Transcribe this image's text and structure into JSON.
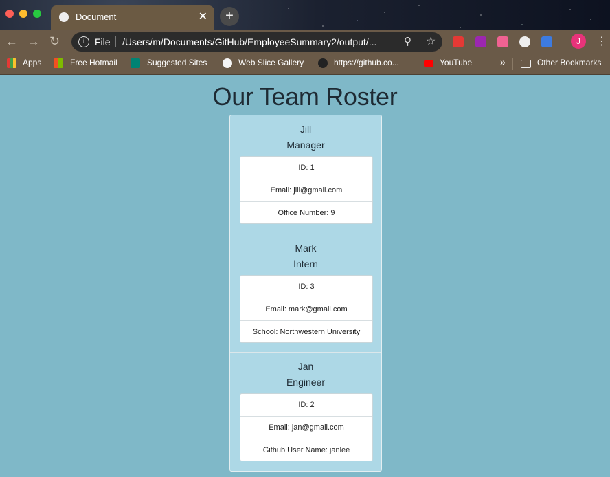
{
  "browser": {
    "tab_title": "Document",
    "url_scheme": "File",
    "url": "/Users/m/Documents/GitHub/EmployeeSummary2/output/...",
    "avatar_initial": "J"
  },
  "bookmarks": [
    {
      "label": "Apps",
      "icon": "apps-grid-icon"
    },
    {
      "label": "Free Hotmail",
      "icon": "microsoft-icon"
    },
    {
      "label": "Suggested Sites",
      "icon": "bing-icon"
    },
    {
      "label": "Web Slice Gallery",
      "icon": "web-slice-icon"
    },
    {
      "label": "https://github.co...",
      "icon": "github-icon"
    },
    {
      "label": "YouTube",
      "icon": "youtube-icon"
    },
    {
      "label": "Other Bookmarks",
      "icon": "folder-icon"
    }
  ],
  "page": {
    "title": "Our Team Roster"
  },
  "employees": [
    {
      "name": "Jill",
      "role": "Manager",
      "id": "ID: 1",
      "email": "Email: jill@gmail.com",
      "extra": "Office Number: 9"
    },
    {
      "name": "Mark",
      "role": "Intern",
      "id": "ID: 3",
      "email": "Email: mark@gmail.com",
      "extra": "School: Northwestern University"
    },
    {
      "name": "Jan",
      "role": "Engineer",
      "id": "ID: 2",
      "email": "Email: jan@gmail.com",
      "extra": "Github User Name: janlee"
    }
  ],
  "colors": {
    "page_background": "#7fb8c8",
    "card_background": "#add8e6"
  }
}
